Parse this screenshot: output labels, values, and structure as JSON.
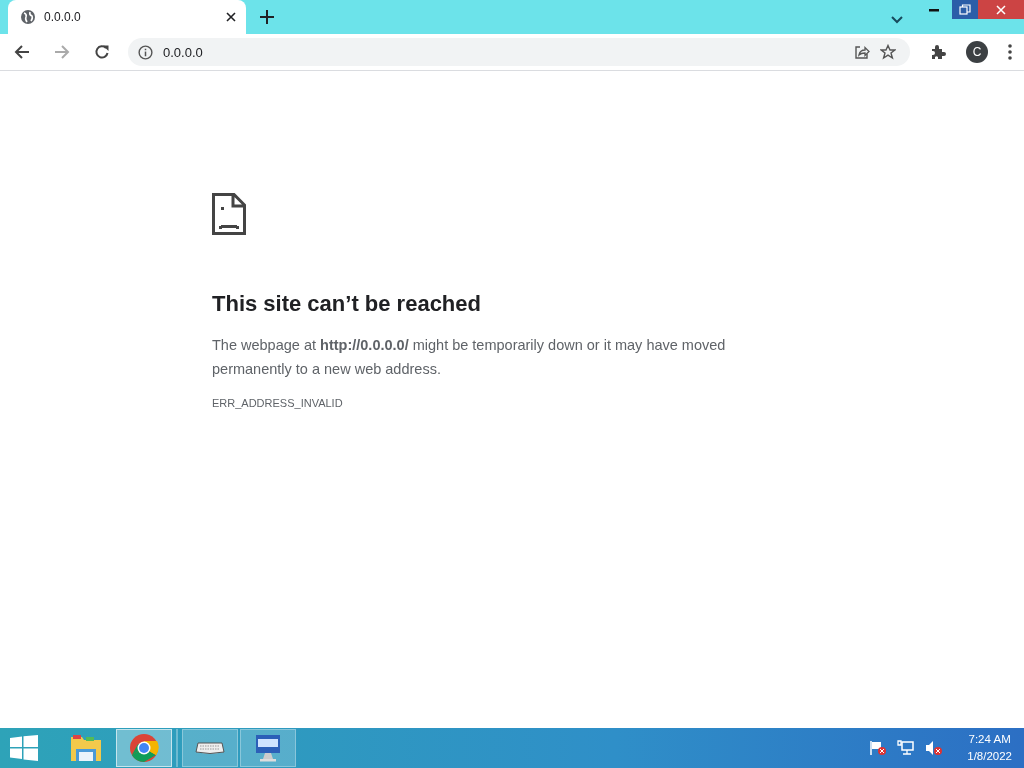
{
  "tabs": [
    {
      "title": "0.0.0.0",
      "selected": true
    }
  ],
  "toolbar": {
    "address": "0.0.0.0",
    "profile_initial": "C"
  },
  "error_page": {
    "heading": "This site can’t be reached",
    "message": "The webpage at **http://0.0.0.0/** might be temporarily down or it may have moved permanently to a new web address.",
    "code": "ERR_ADDRESS_INVALID"
  },
  "taskbar": {
    "items": [
      {
        "kind": "explorer",
        "running": false,
        "selected": false
      },
      {
        "kind": "chrome",
        "running": true,
        "selected": true
      },
      {
        "kind": "keyboard",
        "running": true,
        "selected": false
      },
      {
        "kind": "computer",
        "running": true,
        "selected": false
      }
    ],
    "time": "7:24 AM",
    "date": "1/8/2022"
  }
}
